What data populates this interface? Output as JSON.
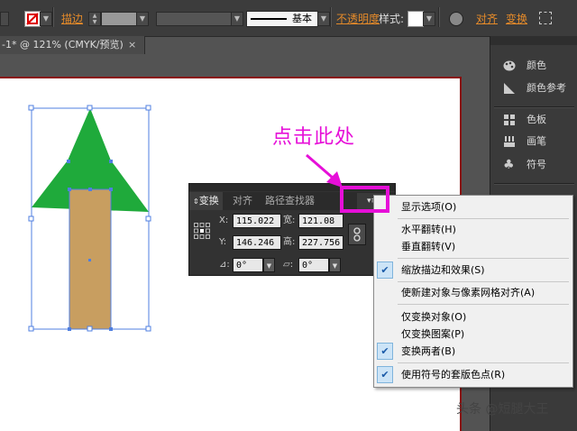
{
  "toolbar": {
    "stroke_label": "描边",
    "stroke_profile": "基本",
    "opacity_label": "不透明度",
    "style_label": "样式:",
    "align_label": "对齐",
    "transform_label": "变换"
  },
  "document": {
    "tab_title": "-1* @ 121% (CMYK/预览)",
    "close": "×"
  },
  "dock": {
    "items": [
      "颜色",
      "颜色参考",
      "色板",
      "画笔",
      "符号"
    ]
  },
  "transform_panel": {
    "tabs": [
      "变换",
      "对齐",
      "路径查找器"
    ],
    "x_label": "X:",
    "x_value": "115.022",
    "y_label": "Y:",
    "y_value": "146.246",
    "w_label": "宽:",
    "w_value": "121.08 p",
    "h_label": "高:",
    "h_value": "227.756",
    "angle_value": "0°",
    "shear_value": "0°"
  },
  "menu": {
    "items": [
      {
        "label": "显示选项(O)",
        "checked": false
      },
      {
        "label": "水平翻转(H)",
        "checked": false
      },
      {
        "label": "垂直翻转(V)",
        "checked": false
      },
      {
        "label": "缩放描边和效果(S)",
        "checked": true
      },
      {
        "label": "使新建对象与像素网格对齐(A)",
        "checked": false
      },
      {
        "label": "仅变换对象(O)",
        "checked": false
      },
      {
        "label": "仅变换图案(P)",
        "checked": false
      },
      {
        "label": "变换两者(B)",
        "checked": true
      },
      {
        "label": "使用符号的套版色点(R)",
        "checked": true
      }
    ]
  },
  "annotation": {
    "callout_text": "点击此处",
    "watermark": "头条 @短腿大王"
  },
  "colors": {
    "tree_green": "#1faa3b",
    "trunk_tan": "#c89e60",
    "selection_blue": "#4f7fe0",
    "highlight_magenta": "#e60fd8",
    "link_orange": "#e48a2a"
  }
}
